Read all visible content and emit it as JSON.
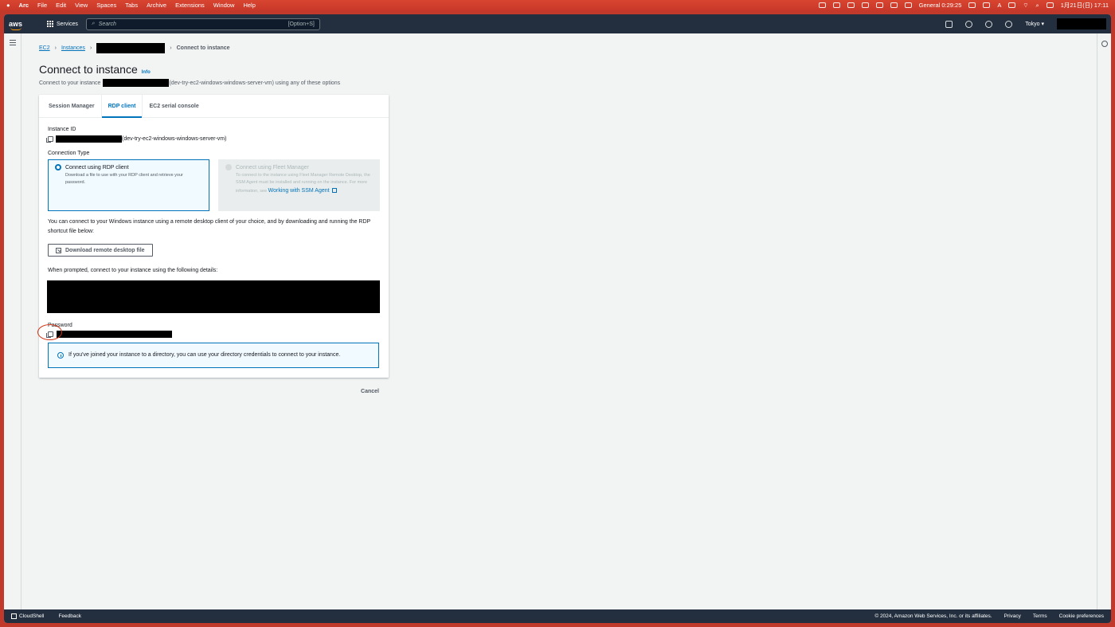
{
  "macbar": {
    "apple": "",
    "app": "Arc",
    "menus": [
      "File",
      "Edit",
      "View",
      "Spaces",
      "Tabs",
      "Archive",
      "Extensions",
      "Window",
      "Help"
    ],
    "focus": "General 0:29:25",
    "input": "A",
    "datetime": "1月21日(日) 17:11"
  },
  "topnav": {
    "logo": "aws",
    "services": "Services",
    "search_placeholder": "Search",
    "search_hint": "[Option+S]",
    "region": "Tokyo ▾"
  },
  "breadcrumb": {
    "ec2": "EC2",
    "instances": "Instances",
    "current": "Connect to instance"
  },
  "header": {
    "title": "Connect to instance",
    "info": "Info",
    "subtitle_prefix": "Connect to your instance",
    "subtitle_suffix": "(dev-try-ec2-windows-windows-server-vm) using any of these options"
  },
  "tabs": [
    "Session Manager",
    "RDP client",
    "EC2 serial console"
  ],
  "rdp": {
    "instance_id_label": "Instance ID",
    "instance_id_suffix": "(dev-try-ec2-windows-windows-server-vm)",
    "connection_type_label": "Connection Type",
    "option_rdp_title": "Connect using RDP client",
    "option_rdp_desc": "Download a file to use with your RDP client and retrieve your password.",
    "option_fleet_title": "Connect using Fleet Manager",
    "option_fleet_desc": "To connect to the instance using Fleet Manager Remote Desktop, the SSM Agent must be installed and running on the instance. For more information, see",
    "option_fleet_link": "Working with SSM Agent",
    "intro": "You can connect to your Windows instance using a remote desktop client of your choice, and by downloading and running the RDP shortcut file below:",
    "download_button": "Download remote desktop file",
    "prompt": "When prompted, connect to your instance using the following details:",
    "password_label": "Password",
    "alert": "If you've joined your instance to a directory, you can use your directory credentials to connect to your instance."
  },
  "cancel": "Cancel",
  "footer": {
    "cloudshell": "CloudShell",
    "feedback": "Feedback",
    "copyright": "© 2024, Amazon Web Services, Inc. or its affiliates.",
    "privacy": "Privacy",
    "terms": "Terms",
    "cookies": "Cookie preferences"
  },
  "colors": {
    "accent": "#0073bb",
    "nav": "#232f3e",
    "annotation": "#d13212"
  }
}
